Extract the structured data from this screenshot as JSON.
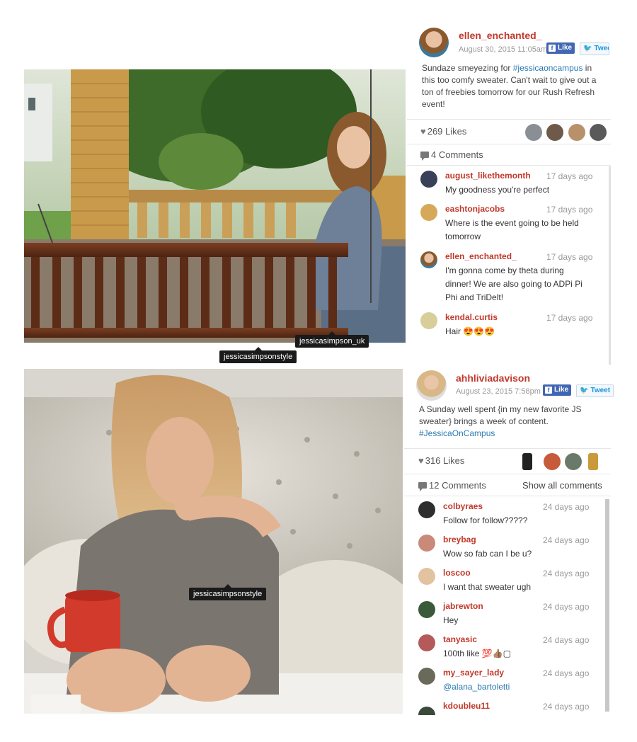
{
  "posts": [
    {
      "username": "ellen_enchanted_",
      "date": "August 30, 2015 11:05am",
      "like_label": "Like",
      "tweet_label": "Tweet",
      "caption_before": "Sundaze smeyezing for ",
      "caption_hashtag": "#jessicaoncampus",
      "caption_after": " in this too comfy sweater. Can't wait to give out a ton of freebies tomorrow for our Rush Refresh event!",
      "likes": "269 Likes",
      "comments_count": "4 Comments",
      "tags": [
        "jessicasimpson_uk",
        "jessicasimpsonstyle"
      ],
      "comments": [
        {
          "user": "august_likethemonth",
          "time": "17 days ago",
          "text": "My goodness you're perfect"
        },
        {
          "user": "eashtonjacobs",
          "time": "17 days ago",
          "text": "Where is the event going to be held tomorrow"
        },
        {
          "user": "ellen_enchanted_",
          "time": "17 days ago",
          "text": "I'm gonna come by theta during dinner! We are also going to ADPi Pi Phi and TriDelt!"
        },
        {
          "user": "kendal.curtis",
          "time": "17 days ago",
          "text": "Hair 😍😍😍"
        }
      ]
    },
    {
      "username": "ahhliviadavison",
      "date": "August 23, 2015 7:58pm",
      "like_label": "Like",
      "tweet_label": "Tweet",
      "caption_before": "A Sunday well spent {in my new favorite JS sweater} brings a week of content. ",
      "caption_hashtag": "#JessicaOnCampus",
      "caption_after": "",
      "likes": "316 Likes",
      "comments_count": "12 Comments",
      "show_all": "Show all comments",
      "tags": [
        "jessicasimpsonstyle"
      ],
      "comments": [
        {
          "user": "colbyraes",
          "time": "24 days ago",
          "text": "Follow for follow?????"
        },
        {
          "user": "breybag",
          "time": "24 days ago",
          "text": "Wow so fab can I be u?"
        },
        {
          "user": "loscoo",
          "time": "24 days ago",
          "text": "I want that sweater ugh"
        },
        {
          "user": "jabrewton",
          "time": "24 days ago",
          "text": "Hey"
        },
        {
          "user": "tanyasic",
          "time": "24 days ago",
          "text": "100th like 💯👍🏽▢"
        },
        {
          "user": "my_sayer_lady",
          "time": "24 days ago",
          "text": "@alana_bartoletti"
        },
        {
          "user": "kdoubleu11",
          "time": "24 days ago",
          "text": ""
        }
      ]
    }
  ],
  "colors": {
    "username": "#c0392b",
    "hashtag": "#2a7ab0",
    "facebook": "#4267b2",
    "twitter": "#1b95e0"
  }
}
